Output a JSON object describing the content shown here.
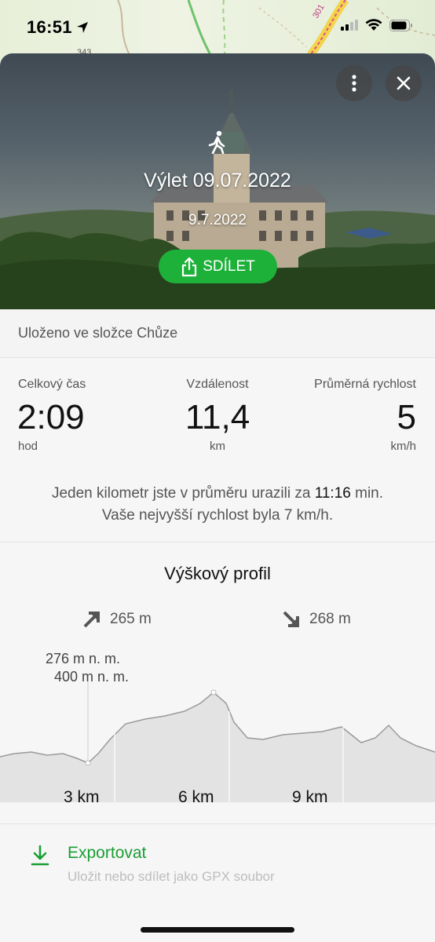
{
  "status_bar": {
    "time": "16:51",
    "map_route_text": "301",
    "map_label": "343"
  },
  "hero": {
    "title": "Výlet 09.07.2022",
    "date": "9.7.2022",
    "share_label": "SDÍLET",
    "activity_icon": "walking-person-icon"
  },
  "folder": {
    "text": "Uloženo ve složce Chůze"
  },
  "stats": {
    "total_time": {
      "label": "Celkový čas",
      "value": "2:09",
      "unit": "hod"
    },
    "distance": {
      "label": "Vzdálenost",
      "value": "11,4",
      "unit": "km"
    },
    "avg_speed": {
      "label": "Průměrná rychlost",
      "value": "5",
      "unit": "km/h"
    },
    "pace_prefix": "Jeden kilometr jste v průměru urazili za",
    "pace_value": "11:16",
    "pace_suffix": "min.",
    "max_speed_text": "Vaše nejvyšší rychlost byla 7 km/h."
  },
  "elevation": {
    "title": "Výškový profil",
    "ascent": "265 m",
    "descent": "268 m",
    "min_marker": "276 m n. m.",
    "max_marker": "400 m n. m.",
    "km_labels": [
      "3 km",
      "6 km",
      "9 km"
    ]
  },
  "export": {
    "title": "Exportovat",
    "subtitle": "Uložit nebo sdílet jako GPX soubor"
  },
  "colors": {
    "accent_green": "#1db13a",
    "export_green": "#1a9e34"
  }
}
